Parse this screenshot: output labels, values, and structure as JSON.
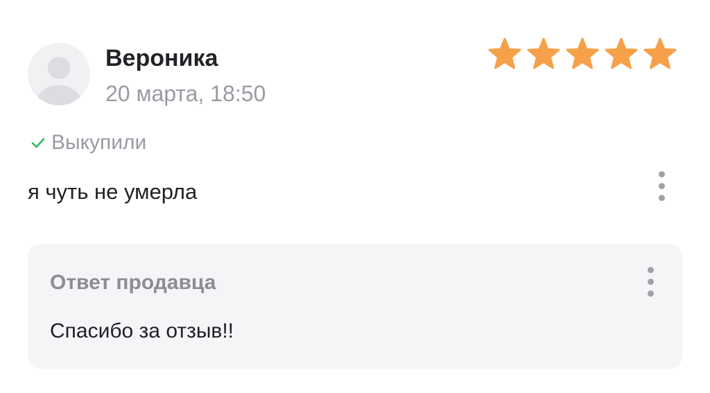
{
  "review": {
    "author_name": "Вероника",
    "date": "20 марта, 18:50",
    "rating": 5,
    "rating_max": 5,
    "purchased_label": "Выкупили",
    "text": "я чуть не умерла"
  },
  "seller_reply": {
    "title": "Ответ продавца",
    "text": "Спасибо за отзыв!!"
  },
  "icons": {
    "avatar": "user-avatar-placeholder",
    "star": "star-icon",
    "check": "check-icon",
    "more": "more-vertical-icon"
  },
  "colors": {
    "star": "#f6a14a",
    "check": "#2fb85a",
    "muted_text": "#9a9aa3",
    "reply_background": "#f5f5f7"
  }
}
